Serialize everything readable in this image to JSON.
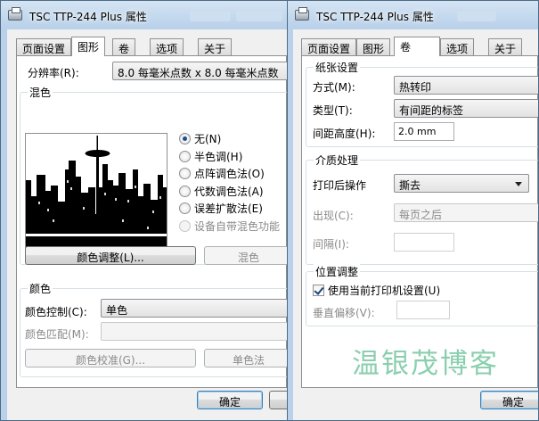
{
  "left_window": {
    "title": "TSC TTP-244 Plus 属性",
    "tabs": [
      "页面设置",
      "图形",
      "卷",
      "选项",
      "关于"
    ],
    "resolution_label": "分辨率(R):",
    "resolution_value": "8.0 每毫米点数 x 8.0 每毫米点数",
    "dither_group_title": "混色",
    "dither_options": [
      "无(N)",
      "半色调(H)",
      "点阵调色法(O)",
      "代数调色法(A)",
      "误差扩散法(E)",
      "设备自带混色功能"
    ],
    "color_adjust_button": "颜色调整(L)...",
    "dither_right_button": "混色",
    "color_group_title": "颜色",
    "color_control_label": "颜色控制(C):",
    "color_control_value": "单色",
    "color_match_label": "颜色匹配(M):",
    "color_calibrate_button": "颜色校准(G)...",
    "mono_button": "单色法",
    "ok_button": "确定"
  },
  "right_window": {
    "title": "TSC TTP-244 Plus 属性",
    "tabs": [
      "页面设置",
      "图形",
      "卷",
      "选项",
      "关于"
    ],
    "stock_group_title": "纸张设置",
    "method_label": "方式(M):",
    "method_value": "热转印",
    "type_label": "类型(T):",
    "type_value": "有间距的标签",
    "gap_label": "间距高度(H):",
    "gap_value": "2.0 mm",
    "media_group_title": "介质处理",
    "post_print_label": "打印后操作",
    "post_print_value": "撕去",
    "occurrence_label": "出现(C):",
    "occurrence_value": "每页之后",
    "interval_label": "间隔(I):",
    "position_group_title": "位置调整",
    "use_current_settings_label": "使用当前打印机设置(U)",
    "vertical_offset_label": "垂直偏移(V):",
    "ok_button": "确定"
  },
  "watermark": "温银茂博客",
  "colors": {
    "window_frame": "#b9d1ea",
    "panel": "#ffffff",
    "watermark": "#8acfae"
  }
}
